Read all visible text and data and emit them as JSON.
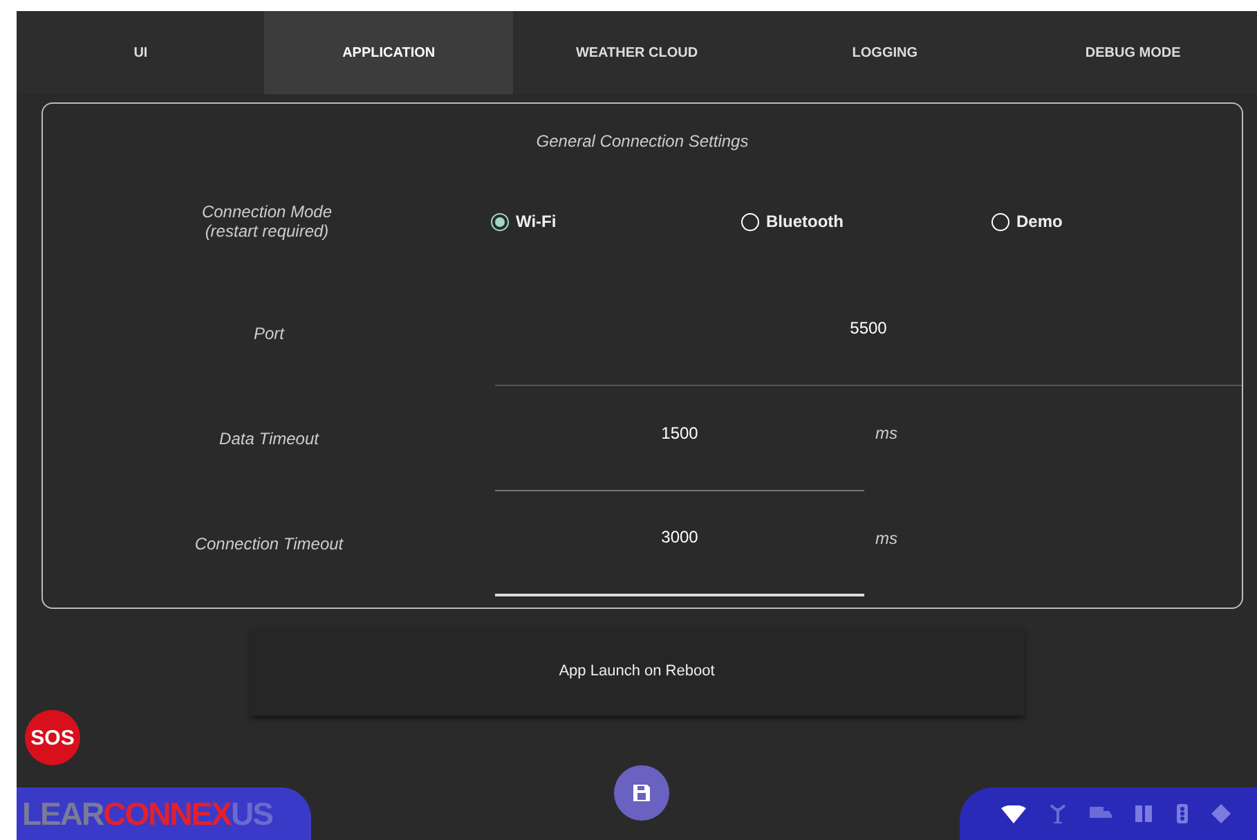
{
  "tabs": [
    {
      "label": "UI",
      "selected": false
    },
    {
      "label": "APPLICATION",
      "selected": true
    },
    {
      "label": "WEATHER CLOUD",
      "selected": false
    },
    {
      "label": "LOGGING",
      "selected": false
    },
    {
      "label": "DEBUG MODE",
      "selected": false
    }
  ],
  "panel": {
    "title": "General Connection Settings",
    "connection_mode": {
      "label": "Connection Mode",
      "note": "(restart required)",
      "options": [
        {
          "label": "Wi-Fi",
          "selected": true
        },
        {
          "label": "Bluetooth",
          "selected": false
        },
        {
          "label": "Demo",
          "selected": false
        }
      ]
    },
    "fields": [
      {
        "label": "Port",
        "value": "5500",
        "focused": false
      },
      {
        "label": "Data Timeout",
        "value": "1500",
        "unit": "ms",
        "focused": false
      },
      {
        "label": "Connection Timeout",
        "value": "3000",
        "unit": "ms",
        "focused": true
      }
    ]
  },
  "app_launch": {
    "label": "App Launch on Reboot"
  },
  "sos": "SOS",
  "logo": [
    "LEAR",
    "CONNEX",
    "US"
  ]
}
